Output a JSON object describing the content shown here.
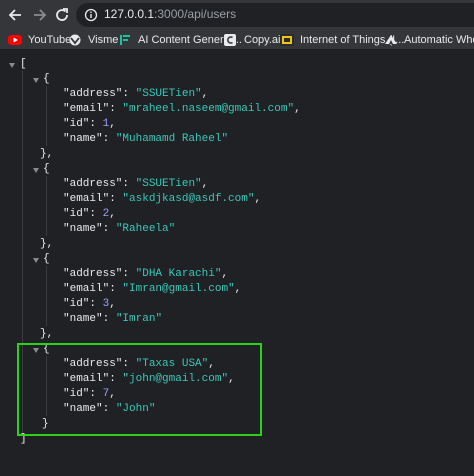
{
  "browser": {
    "url_host": "127.0.0.1",
    "url_path": ":3000/api/users",
    "bookmarks": [
      {
        "label": "YouTube",
        "icon": "youtube-icon"
      },
      {
        "label": "Visme",
        "icon": "visme-icon"
      },
      {
        "label": "AI Content Generat...",
        "icon": "ai-content-icon"
      },
      {
        "label": "Copy.ai",
        "icon": "copy-ai-icon"
      },
      {
        "label": "Internet of Things (I...",
        "icon": "iot-icon"
      },
      {
        "label": "Automatic Whole F",
        "icon": "automatic-icon"
      }
    ]
  },
  "json_view": {
    "open_bracket": "[",
    "close_bracket": "]",
    "users": [
      {
        "address": "SSUETien",
        "email": "mraheel.naseem@gmail.com",
        "id": "1",
        "name": "Muhamamd Raheel"
      },
      {
        "address": "SSUETien",
        "email": "askdjkasd@asdf.com",
        "id": "2",
        "name": "Raheela"
      },
      {
        "address": "DHA Karachi",
        "email": "Imran@gmail.com",
        "id": "3",
        "name": "Imran"
      },
      {
        "address": "Taxas USA",
        "email": "john@gmail.com",
        "id": "7",
        "name": "John"
      }
    ]
  },
  "colors": {
    "highlight_box": "#2cd11a",
    "string_value": "#39c8b9",
    "number_value": "#9aa0ff"
  }
}
